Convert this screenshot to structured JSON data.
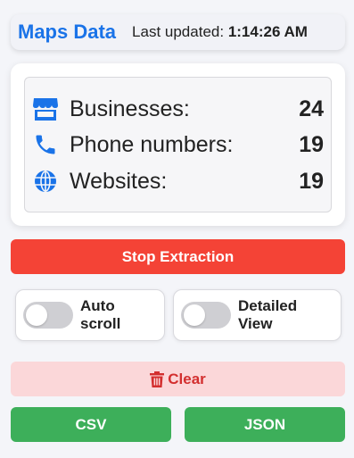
{
  "header": {
    "title": "Maps Data",
    "updated_label": "Last updated:",
    "updated_time": "1:14:26 AM"
  },
  "stats": [
    {
      "icon": "store-icon",
      "label": "Businesses:",
      "value": "24"
    },
    {
      "icon": "phone-icon",
      "label": "Phone numbers:",
      "value": "19"
    },
    {
      "icon": "globe-icon",
      "label": "Websites:",
      "value": "19"
    }
  ],
  "actions": {
    "stop_label": "Stop Extraction",
    "clear_label": "Clear",
    "csv_label": "CSV",
    "json_label": "JSON"
  },
  "toggles": [
    {
      "label_line1": "Auto",
      "label_line2": "scroll",
      "on": false
    },
    {
      "label_line1": "Detailed",
      "label_line2": "View",
      "on": false
    }
  ],
  "colors": {
    "accent": "#1a73e8",
    "stop": "#f44336",
    "clear_bg": "#fbd7d9",
    "clear_text": "#d32f2f",
    "export": "#3daf5a"
  }
}
